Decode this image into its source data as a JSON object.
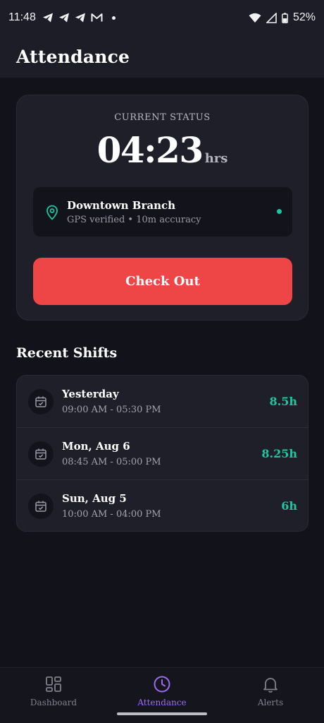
{
  "status_bar": {
    "time": "11:48",
    "battery": "52%"
  },
  "header": {
    "title": "Attendance"
  },
  "status_card": {
    "label": "CURRENT STATUS",
    "timer": "04:23",
    "timer_unit": "hrs",
    "location": {
      "name": "Downtown Branch",
      "detail": "GPS verified • 10m accuracy"
    },
    "checkout_label": "Check Out"
  },
  "recent_shifts": {
    "title": "Recent Shifts",
    "items": [
      {
        "day": "Yesterday",
        "time": "09:00 AM - 05:30 PM",
        "hours": "8.5h"
      },
      {
        "day": "Mon, Aug 6",
        "time": "08:45 AM - 05:00 PM",
        "hours": "8.25h"
      },
      {
        "day": "Sun, Aug 5",
        "time": "10:00 AM - 04:00 PM",
        "hours": "6h"
      }
    ]
  },
  "nav": {
    "items": [
      {
        "label": "Dashboard",
        "icon": "grid-icon"
      },
      {
        "label": "Attendance",
        "icon": "clock-icon",
        "active": true
      },
      {
        "label": "Alerts",
        "icon": "bell-icon"
      }
    ]
  },
  "colors": {
    "accent": "#9b6cf2",
    "danger": "#ee4646",
    "success": "#1fc6a3",
    "background": "#12121a",
    "card": "#1f1f2a"
  }
}
